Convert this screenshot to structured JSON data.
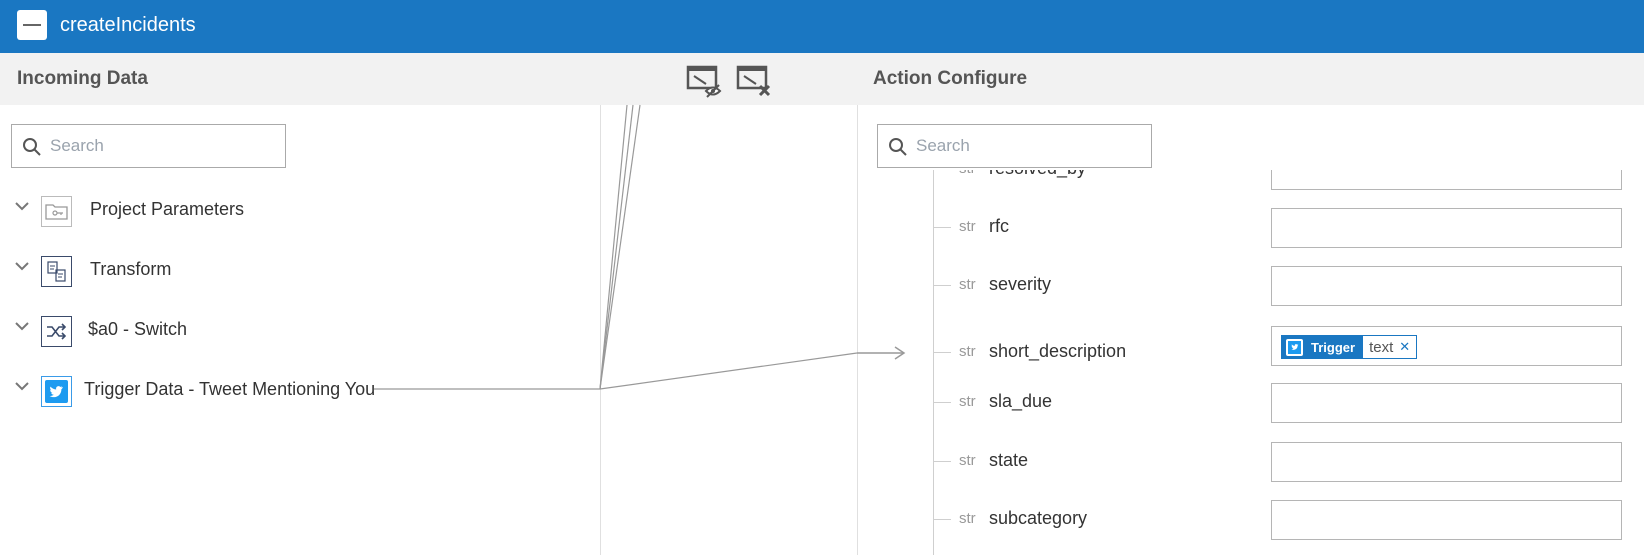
{
  "app": {
    "title": "createIncidents"
  },
  "panels": {
    "incoming": {
      "title": "Incoming Data",
      "search_placeholder": "Search"
    },
    "action": {
      "title": "Action Configure",
      "search_placeholder": "Search"
    }
  },
  "toolbar": {
    "icons": [
      "hide-mappings-icon",
      "clear-mappings-icon"
    ]
  },
  "incoming_tree": [
    {
      "label": "Project Parameters",
      "icon": "folder-key-icon"
    },
    {
      "label": "Transform",
      "icon": "transform-icon"
    },
    {
      "label": "$a0 - Switch",
      "icon": "shuffle-icon"
    },
    {
      "label": "Trigger Data - Tweet Mentioning You",
      "icon": "twitter-icon"
    }
  ],
  "fields": [
    {
      "type": "str",
      "name": "resolved_by"
    },
    {
      "type": "str",
      "name": "rfc"
    },
    {
      "type": "str",
      "name": "severity"
    },
    {
      "type": "str",
      "name": "short_description",
      "chip": {
        "source": "Trigger",
        "value": "text"
      }
    },
    {
      "type": "str",
      "name": "sla_due"
    },
    {
      "type": "str",
      "name": "state"
    },
    {
      "type": "str",
      "name": "subcategory"
    }
  ],
  "colors": {
    "brand": "#1a77c2",
    "subheader": "#f2f2f2"
  }
}
